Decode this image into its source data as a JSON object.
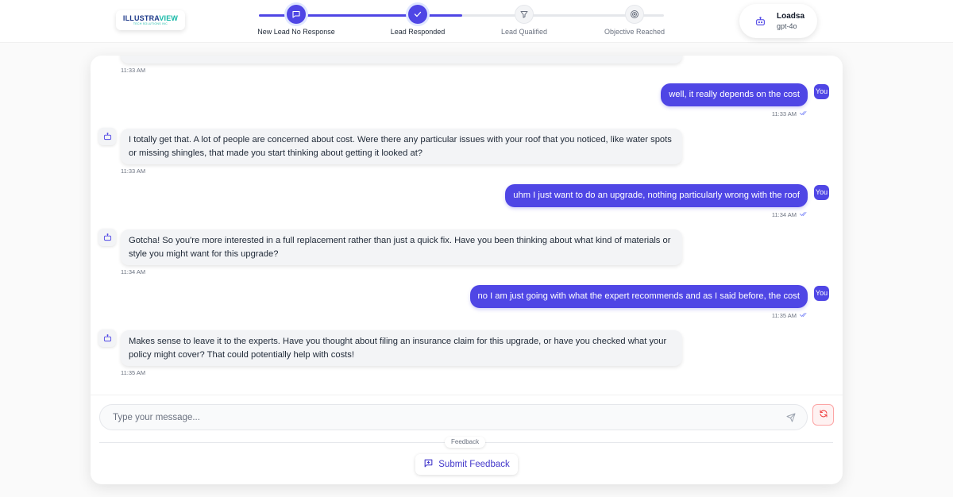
{
  "brand": {
    "logo_part1": "ILLUSTRA",
    "logo_part2": "VIEW",
    "logo_sub": "TECH SOLUTIONS INC"
  },
  "progress": {
    "steps": [
      {
        "label": "New Lead No Response",
        "icon": "chat-bubble-icon",
        "state": "done"
      },
      {
        "label": "Lead Responded",
        "icon": "check-icon",
        "state": "done"
      },
      {
        "label": "Lead Qualified",
        "icon": "filter-icon",
        "state": "pending"
      },
      {
        "label": "Objective Reached",
        "icon": "target-icon",
        "state": "pending"
      }
    ]
  },
  "agent": {
    "name": "Loadsa",
    "model": "gpt-4o",
    "icon": "robot-icon"
  },
  "chat": {
    "you_label": "You",
    "messages": [
      {
        "role": "bot",
        "text": "",
        "time": "11:33 AM"
      },
      {
        "role": "user",
        "text": "well, it really depends on the cost",
        "time": "11:33 AM"
      },
      {
        "role": "bot",
        "text": "I totally get that. A lot of people are concerned about cost. Were there any particular issues with your roof that you noticed, like water spots or missing shingles, that made you start thinking about getting it looked at?",
        "time": "11:33 AM"
      },
      {
        "role": "user",
        "text": "uhm I just want to do an upgrade, nothing particularly wrong with the roof",
        "time": "11:34 AM"
      },
      {
        "role": "bot",
        "text": "Gotcha! So you're more interested in a full replacement rather than just a quick fix. Have you been thinking about what kind of materials or style you might want for this upgrade?",
        "time": "11:34 AM"
      },
      {
        "role": "user",
        "text": "no I am just going with what the expert recommends and as I said before, the cost",
        "time": "11:35 AM"
      },
      {
        "role": "bot",
        "text": "Makes sense to leave it to the experts. Have you thought about filing an insurance claim for this upgrade, or have you checked what your policy might cover? That could potentially help with costs!",
        "time": "11:35 AM"
      }
    ]
  },
  "composer": {
    "placeholder": "Type your message...",
    "value": ""
  },
  "feedback": {
    "label": "Feedback",
    "button": "Submit Feedback"
  },
  "colors": {
    "accent": "#4f46e5",
    "bubble_bot": "#f3f4f6",
    "refresh_bg": "#fef2f2"
  }
}
